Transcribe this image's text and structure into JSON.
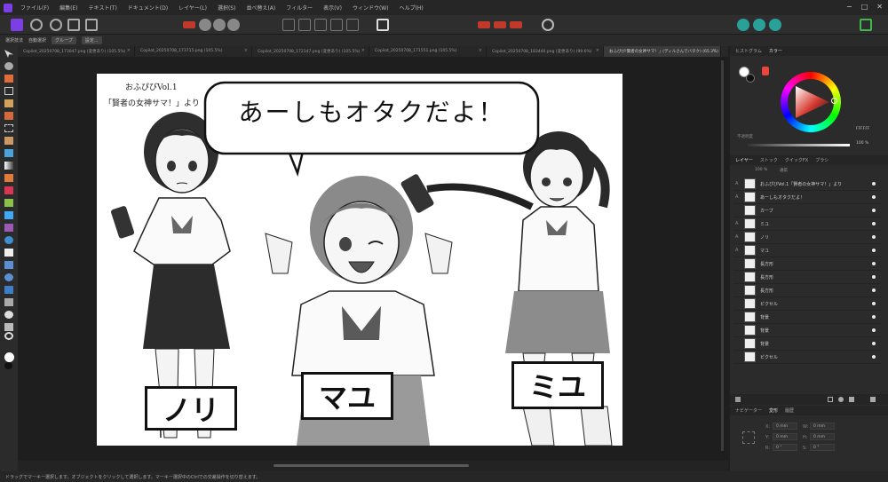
{
  "menu": [
    "ファイル(F)",
    "編集(E)",
    "テキスト(T)",
    "ドキュメント(D)",
    "レイヤー(L)",
    "選択(S)",
    "並べ替え(A)",
    "フィルター",
    "表示(V)",
    "ウィンドウ(W)",
    "ヘルプ(H)"
  ],
  "window_controls": [
    "−",
    "□",
    "✕"
  ],
  "context_bar": {
    "tool_label": "選択技法",
    "checkbox_label": "自動選択",
    "dropdown": "グループ",
    "button": "設定..."
  },
  "tabs": [
    {
      "label": "Copilot_20250708_173047.png (変更あり) (105.5%)",
      "active": false
    },
    {
      "label": "Copilot_20250708_173715.png (105.5%)",
      "active": false
    },
    {
      "label": "Copilot_20250708_172147.png (変更あり) (105.5%)",
      "active": false
    },
    {
      "label": "Copilot_20250708_171551.png (105.5%)",
      "active": false
    },
    {
      "label": "Copilot_20250708_183440.png (変更あり) (99.6%)",
      "active": false
    },
    {
      "label": "おふぴび!賢者の女神サマ！」(ディルさんでバタク) (65.3%)",
      "active": true
    }
  ],
  "document": {
    "title_line1": "おふぴびVol.1",
    "title_line2": "「賢者の女神サマ！」より",
    "speech": "あーしもオタクだよ！",
    "labels": [
      "ノリ",
      "マユ",
      "ミユ"
    ]
  },
  "color_panel": {
    "tabs": [
      "ヒストグラム",
      "カラー"
    ],
    "opacity_label": "不透明度",
    "opacity_value": "100 %",
    "hex": "FFFFFF"
  },
  "layers_panel": {
    "tabs": [
      "レイヤー",
      "ストック",
      "クイックFX",
      "ブラシ"
    ],
    "blend": "通常",
    "opacity": "100 %",
    "rows": [
      {
        "name": "おふぴびVol.1「賢者の女神サマ！」より",
        "type": "A"
      },
      {
        "name": "あーしもオタクだよ！",
        "type": "A"
      },
      {
        "name": "カーブ",
        "type": ""
      },
      {
        "name": "ミユ",
        "type": "A"
      },
      {
        "name": "ノリ",
        "type": "A"
      },
      {
        "name": "マユ",
        "type": "A"
      },
      {
        "name": "長方形",
        "type": ""
      },
      {
        "name": "長方形",
        "type": ""
      },
      {
        "name": "長方形",
        "type": ""
      },
      {
        "name": "ピクセル",
        "type": ""
      },
      {
        "name": "背景",
        "type": ""
      },
      {
        "name": "背景",
        "type": ""
      },
      {
        "name": "背景",
        "type": ""
      },
      {
        "name": "ピクセル",
        "type": ""
      }
    ]
  },
  "transform_panel": {
    "tabs": [
      "ナビゲーター",
      "変形",
      "履歴"
    ],
    "fields": [
      {
        "label": "X:",
        "value": "0 mm"
      },
      {
        "label": "Y:",
        "value": "0 mm"
      },
      {
        "label": "W:",
        "value": "0 mm"
      },
      {
        "label": "H:",
        "value": "0 mm"
      },
      {
        "label": "R:",
        "value": "0 °"
      },
      {
        "label": "S:",
        "value": "0 °"
      }
    ]
  },
  "status": "ドラッグでマーキー選択します。オブジェクトをクリックして選択します。マーキー選択中のCtrlでの交差操作を切り替えます。"
}
